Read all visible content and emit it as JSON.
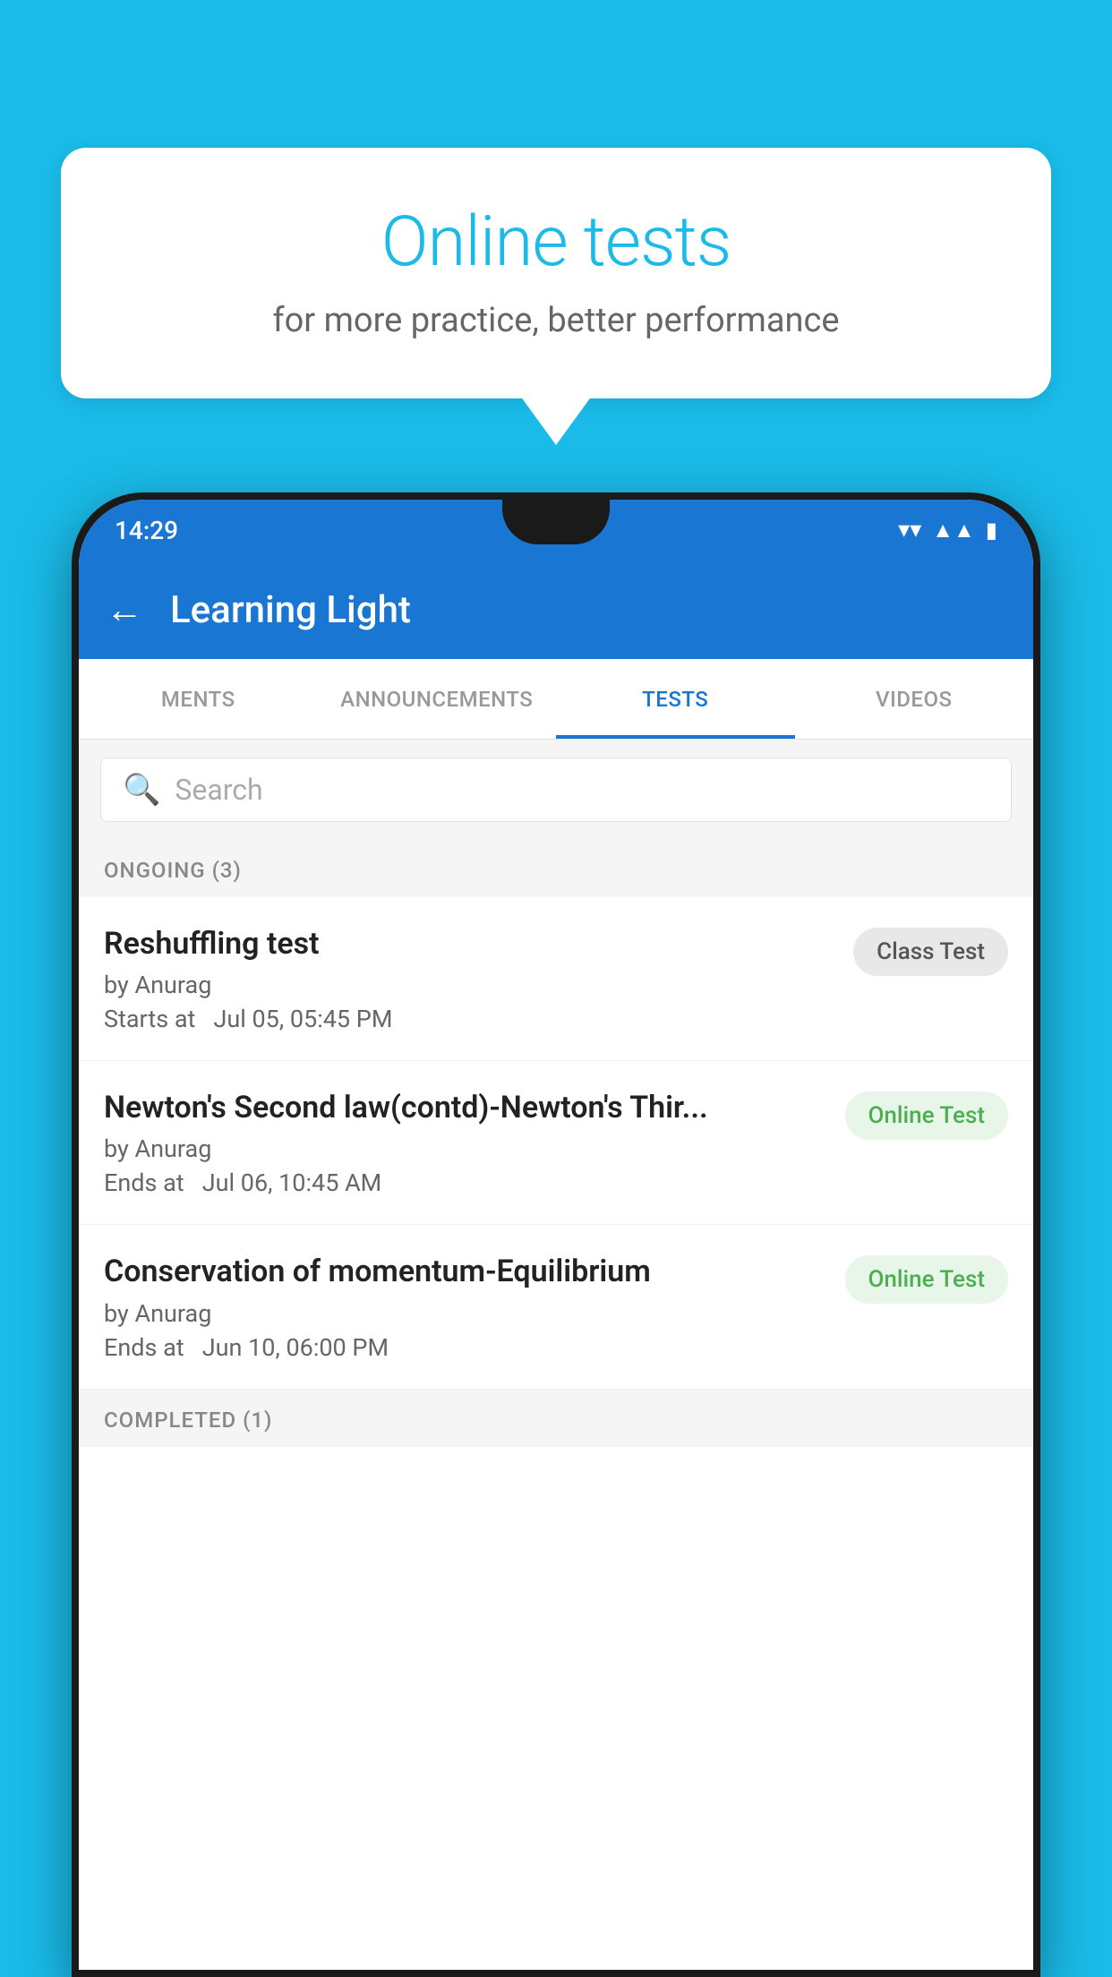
{
  "background_color": "#1ABBE8",
  "speech_bubble": {
    "title": "Online tests",
    "subtitle": "for more practice, better performance"
  },
  "phone": {
    "status_bar": {
      "time": "14:29",
      "icons": [
        "wifi",
        "signal",
        "battery"
      ]
    },
    "app_bar": {
      "title": "Learning Light",
      "back_button_label": "←"
    },
    "tabs": [
      {
        "label": "MENTS",
        "active": false
      },
      {
        "label": "ANNOUNCEMENTS",
        "active": false
      },
      {
        "label": "TESTS",
        "active": true
      },
      {
        "label": "VIDEOS",
        "active": false
      }
    ],
    "search": {
      "placeholder": "Search"
    },
    "ongoing_section": {
      "label": "ONGOING (3)"
    },
    "tests": [
      {
        "name": "Reshuffling test",
        "author": "by Anurag",
        "time_label": "Starts at",
        "time": "Jul 05, 05:45 PM",
        "badge": "Class Test",
        "badge_type": "class"
      },
      {
        "name": "Newton's Second law(contd)-Newton's Thir...",
        "author": "by Anurag",
        "time_label": "Ends at",
        "time": "Jul 06, 10:45 AM",
        "badge": "Online Test",
        "badge_type": "online"
      },
      {
        "name": "Conservation of momentum-Equilibrium",
        "author": "by Anurag",
        "time_label": "Ends at",
        "time": "Jun 10, 06:00 PM",
        "badge": "Online Test",
        "badge_type": "online"
      }
    ],
    "completed_section": {
      "label": "COMPLETED (1)"
    }
  }
}
